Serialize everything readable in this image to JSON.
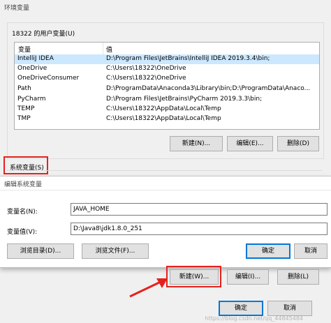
{
  "window": {
    "title": "环境变量"
  },
  "user_vars": {
    "group_label": "18322 的用户变量(U)",
    "columns": [
      "变量",
      "值"
    ],
    "rows": [
      {
        "name": "IntelliJ IDEA",
        "value": "D:\\Program Files\\JetBrains\\IntelliJ IDEA 2019.3.4\\bin;"
      },
      {
        "name": "OneDrive",
        "value": "C:\\Users\\18322\\OneDrive"
      },
      {
        "name": "OneDriveConsumer",
        "value": "C:\\Users\\18322\\OneDrive"
      },
      {
        "name": "Path",
        "value": "D:\\ProgramData\\Anaconda3\\Library\\bin;D:\\ProgramData\\Anaco..."
      },
      {
        "name": "PyCharm",
        "value": "D:\\Program Files\\JetBrains\\PyCharm 2019.3.3\\bin;"
      },
      {
        "name": "TEMP",
        "value": "C:\\Users\\18322\\AppData\\Local\\Temp"
      },
      {
        "name": "TMP",
        "value": "C:\\Users\\18322\\AppData\\Local\\Temp"
      }
    ],
    "buttons": {
      "new": "新建(N)...",
      "edit": "编辑(E)...",
      "delete": "删除(D)"
    }
  },
  "system_vars": {
    "group_label": "系统变量(S)",
    "buttons": {
      "new": "新建(W)...",
      "edit": "编辑(I)...",
      "delete": "删除(L)"
    }
  },
  "edit_dialog": {
    "title": "编辑系统变量",
    "name_label": "变量名(N):",
    "name_value": "JAVA_HOME",
    "value_label": "变量值(V):",
    "value_value": "D:\\Java8\\jdk1.8.0_251",
    "browse_dir": "浏览目录(D)...",
    "browse_file": "浏览文件(F)...",
    "ok": "确定",
    "cancel": "取消"
  },
  "footer": {
    "ok": "确定",
    "cancel": "取消"
  },
  "watermark": "https://blog.csdn.net/qq_44845484",
  "colors": {
    "highlight": "#e5211d",
    "selection": "#cce8ff",
    "accent": "#0078d7"
  }
}
